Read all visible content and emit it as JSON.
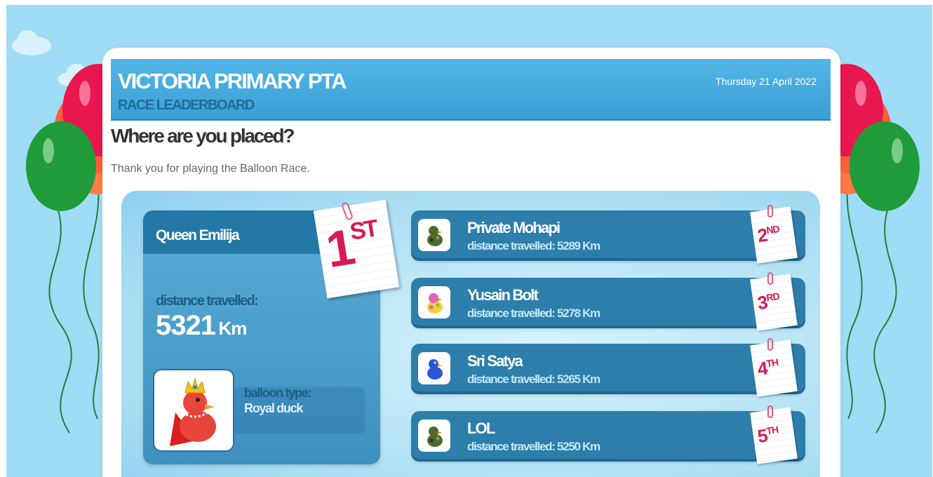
{
  "header": {
    "title": "VICTORIA PRIMARY PTA",
    "subtitle": "RACE LEADERBOARD",
    "date": "Thursday 21 April 2022"
  },
  "intro": {
    "question": "Where are you placed?",
    "thanks": "Thank you for playing the Balloon Race."
  },
  "winner": {
    "name": "Queen Emilija",
    "distance_label": "distance travelled:",
    "distance": "5321",
    "unit": "Km",
    "balloon_type_label": "balloon type:",
    "balloon_type": "Royal duck",
    "place": "1",
    "place_suffix": "ST",
    "icon": "royal-duck-icon"
  },
  "runners": [
    {
      "name": "Private Mohapi",
      "distance_label": "distance travelled:",
      "distance": "5289 Km",
      "place": "2",
      "place_suffix": "ND",
      "icon": "camo-duck-icon"
    },
    {
      "name": "Yusain Bolt",
      "distance_label": "distance travelled:",
      "distance": "5278 Km",
      "place": "3",
      "place_suffix": "RD",
      "icon": "pink-duck-icon"
    },
    {
      "name": "Sri Satya",
      "distance_label": "distance travelled:",
      "distance": "5265 Km",
      "place": "4",
      "place_suffix": "TH",
      "icon": "blue-duck-icon"
    },
    {
      "name": "LOL",
      "distance_label": "distance travelled:",
      "distance": "5250 Km",
      "place": "5",
      "place_suffix": "TH",
      "icon": "camo-duck-icon"
    }
  ],
  "colors": {
    "sky": "#9fdcf6",
    "header": "#3a9fd6",
    "row": "#2e7eab",
    "place": "#d81a54"
  }
}
